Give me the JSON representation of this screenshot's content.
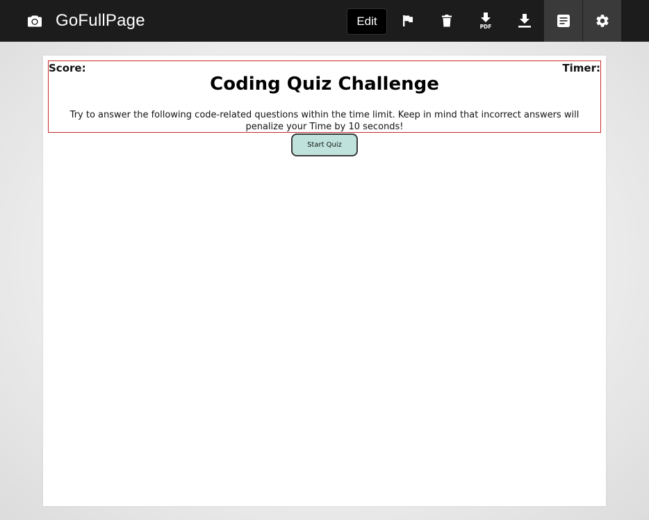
{
  "toolbar": {
    "app_title": "GoFullPage",
    "edit_label": "Edit",
    "icons": {
      "camera": "camera-icon",
      "flag": "flag-icon",
      "delete": "trash-icon",
      "download_pdf": "download-pdf-icon",
      "download": "download-icon",
      "document": "document-icon",
      "settings": "gear-icon"
    },
    "pdf_badge": "PDF",
    "active_button": "document"
  },
  "page": {
    "score_label": "Score:",
    "timer_label": "Timer:",
    "title": "Coding Quiz Challenge",
    "instructions": "Try to answer the following code-related questions within the time limit. Keep in mind that incorrect answers will penalize your Time by 10 seconds!",
    "start_button_label": "Start Quiz"
  },
  "colors": {
    "toolbar_bg": "#1c1c1c",
    "active_button_bg": "#3a3a3a",
    "header_border": "#c62828",
    "start_button_bg": "#bfe3dc"
  }
}
